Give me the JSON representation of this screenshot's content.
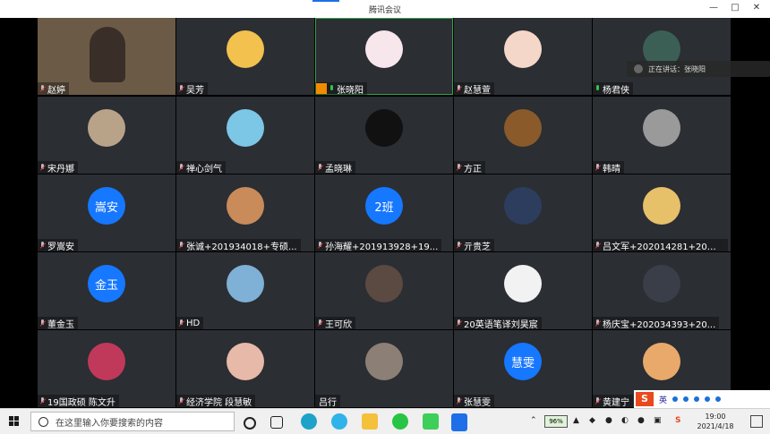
{
  "window": {
    "title": "腾讯会议",
    "minimize": "—",
    "maximize": "□",
    "close": "✕"
  },
  "speaking_indicator": "正在讲话：张晓阳",
  "participants": [
    {
      "name": "赵婷",
      "muted": true,
      "avatar_text": "",
      "avatar_color": "#6b5a45"
    },
    {
      "name": "吴芳",
      "muted": true,
      "avatar_text": "",
      "avatar_color": "#f2c14e"
    },
    {
      "name": "张晓阳",
      "muted": false,
      "host": true,
      "avatar_text": "",
      "avatar_color": "#f7e6ec"
    },
    {
      "name": "赵慧萱",
      "muted": true,
      "avatar_text": "",
      "avatar_color": "#f5d7c9"
    },
    {
      "name": "杨君侠",
      "muted": false,
      "avatar_text": "",
      "avatar_color": "#3c5f55"
    },
    {
      "name": "宋丹娜",
      "muted": true,
      "avatar_text": "",
      "avatar_color": "#b8a389"
    },
    {
      "name": "禅心剑气",
      "muted": true,
      "avatar_text": "",
      "avatar_color": "#7cc6e6"
    },
    {
      "name": "孟晓琳",
      "muted": true,
      "avatar_text": "",
      "avatar_color": "#111111"
    },
    {
      "name": "方正",
      "muted": true,
      "avatar_text": "",
      "avatar_color": "#8a5a2b"
    },
    {
      "name": "韩晴",
      "muted": true,
      "avatar_text": "",
      "avatar_color": "#9a9a9a"
    },
    {
      "name": "罗嵩安",
      "muted": true,
      "avatar_text": "嵩安",
      "avatar_color": "#1677ff"
    },
    {
      "name": "张诚+201934018+专硕...",
      "muted": true,
      "avatar_text": "",
      "avatar_color": "#c98b5a"
    },
    {
      "name": "孙海耀+201913928+19...",
      "muted": true,
      "avatar_text": "2班",
      "avatar_color": "#1677ff"
    },
    {
      "name": "亓贵芝",
      "muted": true,
      "avatar_text": "",
      "avatar_color": "#2d3d5e"
    },
    {
      "name": "吕文军+202014281+20学...",
      "muted": true,
      "avatar_text": "",
      "avatar_color": "#e7c06a"
    },
    {
      "name": "董金玉",
      "muted": true,
      "avatar_text": "金玉",
      "avatar_color": "#1677ff"
    },
    {
      "name": "HD",
      "muted": true,
      "avatar_text": "",
      "avatar_color": "#7fb0d6"
    },
    {
      "name": "王可欣",
      "muted": true,
      "avatar_text": "",
      "avatar_color": "#5a4a42"
    },
    {
      "name": "20英语笔译刘昊宸",
      "muted": true,
      "avatar_text": "",
      "avatar_color": "#f2f2f2"
    },
    {
      "name": "杨庆宝+202034393+20...",
      "muted": true,
      "avatar_text": "",
      "avatar_color": "#3a3e48"
    },
    {
      "name": "19国政硕 陈文升",
      "muted": true,
      "avatar_text": "",
      "avatar_color": "#c0395a"
    },
    {
      "name": "经济学院 段慧敏",
      "muted": true,
      "avatar_text": "",
      "avatar_color": "#e7b9a8"
    },
    {
      "name": "吕行",
      "muted": null,
      "avatar_text": "",
      "avatar_color": "#8c7f75"
    },
    {
      "name": "张慧雯",
      "muted": true,
      "avatar_text": "慧雯",
      "avatar_color": "#1677ff"
    },
    {
      "name": "黄建宁",
      "muted": true,
      "avatar_text": "",
      "avatar_color": "#e8a96a"
    }
  ],
  "taskbar": {
    "search_placeholder": "在这里输入你要搜索的内容",
    "battery": "96%",
    "time": "19:00",
    "date": "2021/4/18",
    "ime_logo": "S",
    "ime_lang": "英"
  }
}
